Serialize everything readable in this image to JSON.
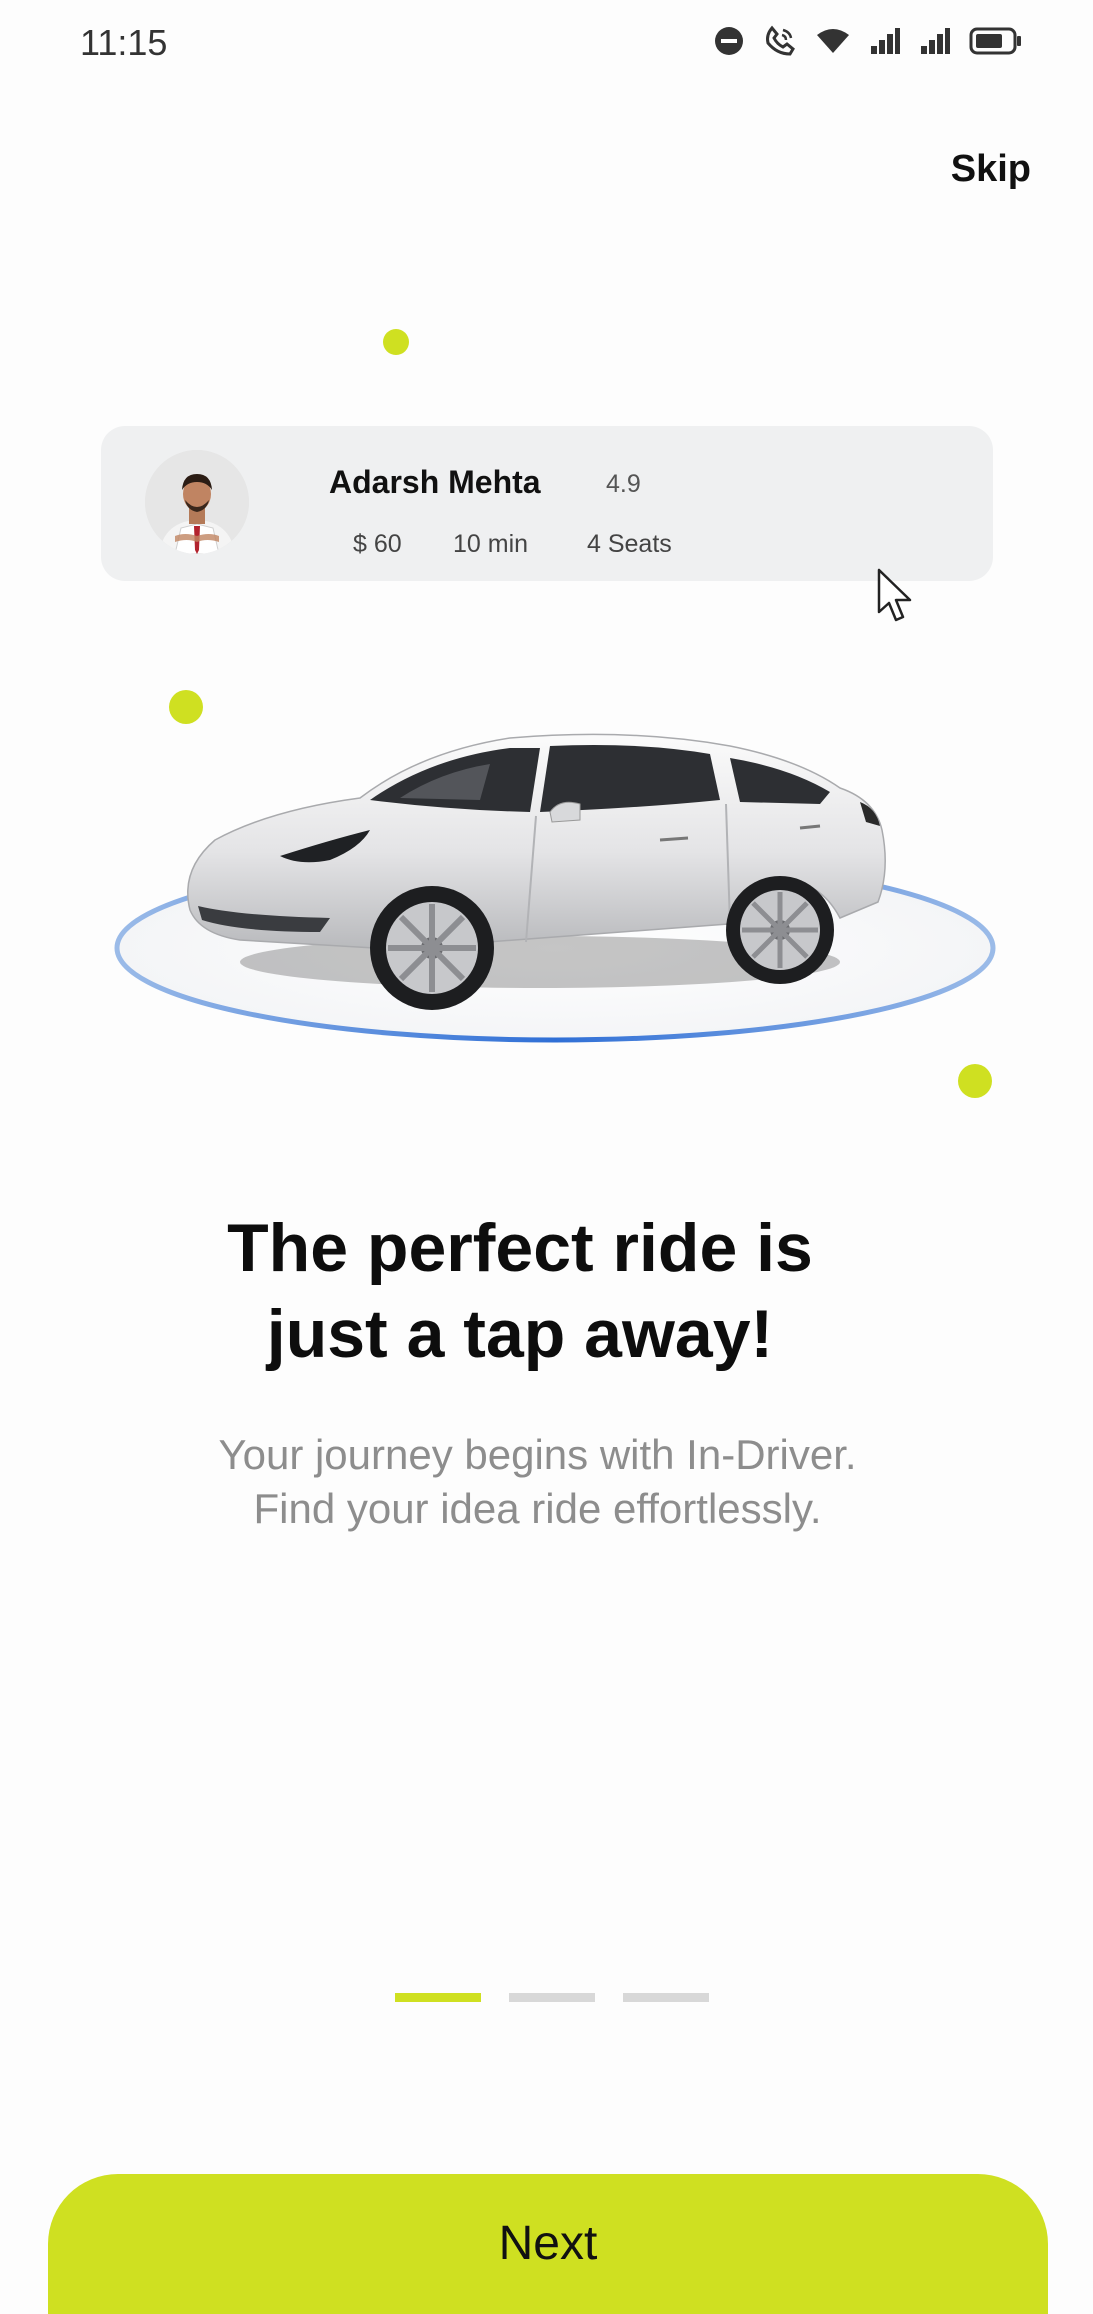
{
  "status_bar": {
    "time": "11:15",
    "icons": [
      "do-not-disturb-icon",
      "call-icon",
      "wifi-icon",
      "signal-icon",
      "signal-icon",
      "battery-icon"
    ]
  },
  "header": {
    "skip_label": "Skip"
  },
  "driver_card": {
    "name": "Adarsh Mehta",
    "rating": "4.9",
    "price": "$ 60",
    "eta": "10 min",
    "seats": "4 Seats"
  },
  "hero": {
    "headline_line1": "The perfect ride is",
    "headline_line2": "just a tap away!",
    "subtitle_line1": "Your journey begins with In-Driver.",
    "subtitle_line2": "Find your idea ride effortlessly."
  },
  "pagination": {
    "total": 3,
    "active_index": 0
  },
  "footer": {
    "next_label": "Next"
  },
  "colors": {
    "accent": "#cfe021",
    "card_bg": "#eff0f1",
    "ring": "#2f6fd6",
    "subtitle": "#8d8d8d"
  }
}
